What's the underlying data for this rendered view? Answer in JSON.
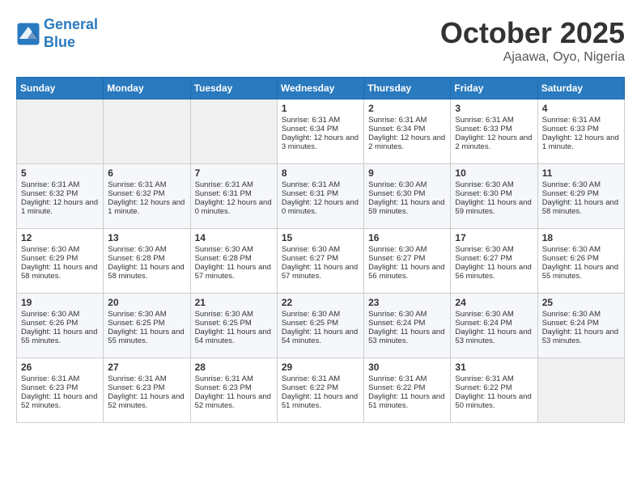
{
  "header": {
    "logo_line1": "General",
    "logo_line2": "Blue",
    "month": "October 2025",
    "location": "Ajaawa, Oyo, Nigeria"
  },
  "weekdays": [
    "Sunday",
    "Monday",
    "Tuesday",
    "Wednesday",
    "Thursday",
    "Friday",
    "Saturday"
  ],
  "weeks": [
    [
      {
        "day": "",
        "empty": true
      },
      {
        "day": "",
        "empty": true
      },
      {
        "day": "",
        "empty": true
      },
      {
        "day": "1",
        "sunrise": "6:31 AM",
        "sunset": "6:34 PM",
        "daylight": "12 hours and 3 minutes."
      },
      {
        "day": "2",
        "sunrise": "6:31 AM",
        "sunset": "6:34 PM",
        "daylight": "12 hours and 2 minutes."
      },
      {
        "day": "3",
        "sunrise": "6:31 AM",
        "sunset": "6:33 PM",
        "daylight": "12 hours and 2 minutes."
      },
      {
        "day": "4",
        "sunrise": "6:31 AM",
        "sunset": "6:33 PM",
        "daylight": "12 hours and 1 minute."
      }
    ],
    [
      {
        "day": "5",
        "sunrise": "6:31 AM",
        "sunset": "6:32 PM",
        "daylight": "12 hours and 1 minute."
      },
      {
        "day": "6",
        "sunrise": "6:31 AM",
        "sunset": "6:32 PM",
        "daylight": "12 hours and 1 minute."
      },
      {
        "day": "7",
        "sunrise": "6:31 AM",
        "sunset": "6:31 PM",
        "daylight": "12 hours and 0 minutes."
      },
      {
        "day": "8",
        "sunrise": "6:31 AM",
        "sunset": "6:31 PM",
        "daylight": "12 hours and 0 minutes."
      },
      {
        "day": "9",
        "sunrise": "6:30 AM",
        "sunset": "6:30 PM",
        "daylight": "11 hours and 59 minutes."
      },
      {
        "day": "10",
        "sunrise": "6:30 AM",
        "sunset": "6:30 PM",
        "daylight": "11 hours and 59 minutes."
      },
      {
        "day": "11",
        "sunrise": "6:30 AM",
        "sunset": "6:29 PM",
        "daylight": "11 hours and 58 minutes."
      }
    ],
    [
      {
        "day": "12",
        "sunrise": "6:30 AM",
        "sunset": "6:29 PM",
        "daylight": "11 hours and 58 minutes."
      },
      {
        "day": "13",
        "sunrise": "6:30 AM",
        "sunset": "6:28 PM",
        "daylight": "11 hours and 58 minutes."
      },
      {
        "day": "14",
        "sunrise": "6:30 AM",
        "sunset": "6:28 PM",
        "daylight": "11 hours and 57 minutes."
      },
      {
        "day": "15",
        "sunrise": "6:30 AM",
        "sunset": "6:27 PM",
        "daylight": "11 hours and 57 minutes."
      },
      {
        "day": "16",
        "sunrise": "6:30 AM",
        "sunset": "6:27 PM",
        "daylight": "11 hours and 56 minutes."
      },
      {
        "day": "17",
        "sunrise": "6:30 AM",
        "sunset": "6:27 PM",
        "daylight": "11 hours and 56 minutes."
      },
      {
        "day": "18",
        "sunrise": "6:30 AM",
        "sunset": "6:26 PM",
        "daylight": "11 hours and 55 minutes."
      }
    ],
    [
      {
        "day": "19",
        "sunrise": "6:30 AM",
        "sunset": "6:26 PM",
        "daylight": "11 hours and 55 minutes."
      },
      {
        "day": "20",
        "sunrise": "6:30 AM",
        "sunset": "6:25 PM",
        "daylight": "11 hours and 55 minutes."
      },
      {
        "day": "21",
        "sunrise": "6:30 AM",
        "sunset": "6:25 PM",
        "daylight": "11 hours and 54 minutes."
      },
      {
        "day": "22",
        "sunrise": "6:30 AM",
        "sunset": "6:25 PM",
        "daylight": "11 hours and 54 minutes."
      },
      {
        "day": "23",
        "sunrise": "6:30 AM",
        "sunset": "6:24 PM",
        "daylight": "11 hours and 53 minutes."
      },
      {
        "day": "24",
        "sunrise": "6:30 AM",
        "sunset": "6:24 PM",
        "daylight": "11 hours and 53 minutes."
      },
      {
        "day": "25",
        "sunrise": "6:30 AM",
        "sunset": "6:24 PM",
        "daylight": "11 hours and 53 minutes."
      }
    ],
    [
      {
        "day": "26",
        "sunrise": "6:31 AM",
        "sunset": "6:23 PM",
        "daylight": "11 hours and 52 minutes."
      },
      {
        "day": "27",
        "sunrise": "6:31 AM",
        "sunset": "6:23 PM",
        "daylight": "11 hours and 52 minutes."
      },
      {
        "day": "28",
        "sunrise": "6:31 AM",
        "sunset": "6:23 PM",
        "daylight": "11 hours and 52 minutes."
      },
      {
        "day": "29",
        "sunrise": "6:31 AM",
        "sunset": "6:22 PM",
        "daylight": "11 hours and 51 minutes."
      },
      {
        "day": "30",
        "sunrise": "6:31 AM",
        "sunset": "6:22 PM",
        "daylight": "11 hours and 51 minutes."
      },
      {
        "day": "31",
        "sunrise": "6:31 AM",
        "sunset": "6:22 PM",
        "daylight": "11 hours and 50 minutes."
      },
      {
        "day": "",
        "empty": true
      }
    ]
  ]
}
